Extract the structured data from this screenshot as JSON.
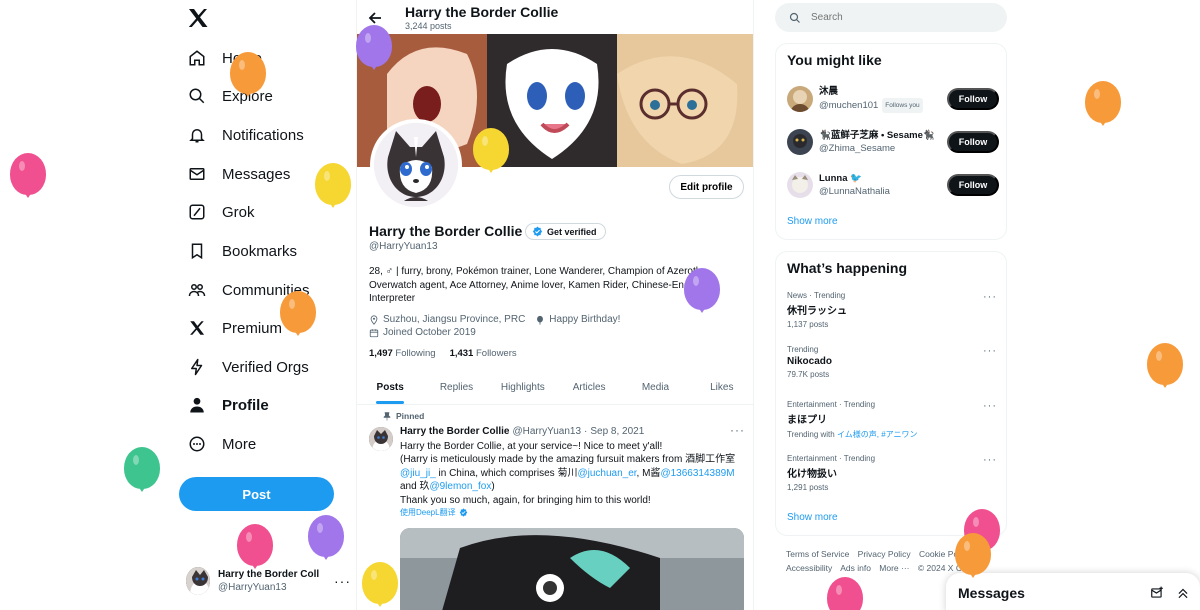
{
  "colors": {
    "accent": "#1d9bf0",
    "text": "#0f1419",
    "muted": "#536471",
    "balloon_orange": "#f79a3a",
    "balloon_yellow": "#f6d631",
    "balloon_pink": "#f0508f",
    "balloon_purple": "#a176ea",
    "balloon_green": "#3ec48e"
  },
  "nav": {
    "logo": "x-logo-icon",
    "items": [
      {
        "label": "Home",
        "icon": "home-icon"
      },
      {
        "label": "Explore",
        "icon": "search-icon"
      },
      {
        "label": "Notifications",
        "icon": "bell-icon"
      },
      {
        "label": "Messages",
        "icon": "envelope-icon"
      },
      {
        "label": "Grok",
        "icon": "grok-icon"
      },
      {
        "label": "Bookmarks",
        "icon": "bookmark-icon"
      },
      {
        "label": "Communities",
        "icon": "people-icon"
      },
      {
        "label": "Premium",
        "icon": "x-logo-icon"
      },
      {
        "label": "Verified Orgs",
        "icon": "lightning-icon"
      },
      {
        "label": "Profile",
        "icon": "person-icon",
        "active": true
      },
      {
        "label": "More",
        "icon": "more-circle-icon"
      }
    ],
    "post_label": "Post",
    "account": {
      "name": "Harry the Border Coll",
      "handle": "@HarryYuan13",
      "more": "···"
    }
  },
  "profile": {
    "header_title": "Harry the Border Collie",
    "post_count": "3,244 posts",
    "edit_label": "Edit profile",
    "display_name": "Harry the Border Collie",
    "get_verified": "Get verified",
    "handle": "@HarryYuan13",
    "bio": "28, ♂ | furry, brony, Pokémon trainer, Lone Wanderer, Champion of Azeroth, Overwatch agent, Ace Attorney, Anime lover, Kamen Rider, Chinese-English Interpreter",
    "location": "Suzhou, Jiangsu Province, PRC",
    "birthday": "Happy Birthday!",
    "joined": "Joined October 2019",
    "following_count": "1,497",
    "following_label": "Following",
    "followers_count": "1,431",
    "followers_label": "Followers"
  },
  "tabs": [
    "Posts",
    "Replies",
    "Highlights",
    "Articles",
    "Media",
    "Likes"
  ],
  "tweet": {
    "pinned_label": "Pinned",
    "author": "Harry the Border Collie",
    "handle": "@HarryYuan13",
    "sep": "·",
    "date": "Sep 8, 2021",
    "line1": "Harry the Border Collie, at your service~! Nice to meet y'all!",
    "line2": "(Harry is meticulously made by the amazing fursuit makers from 酒脚工作室",
    "mention1": "@jiu_ji_",
    "line3a": " in China, which comprises 菊川",
    "mention2": "@juchuan_er",
    "line3b": ", M酱",
    "mention3": "@1366314389M",
    "line4a": "and 玖",
    "mention4": "@9lemon_fox",
    "line4b": ")",
    "line5": "Thank you so much, again, for bringing him to this world!",
    "translate": "使用DeepL翻译",
    "more": "···"
  },
  "search": {
    "placeholder": "Search"
  },
  "who_to_follow": {
    "title": "You might like",
    "users": [
      {
        "name": "沐晨",
        "handle": "@muchen101",
        "badge": "Follows you",
        "button": "Follow"
      },
      {
        "name": "🐈‍⬛蓝鲜子芝麻 • Sesame🐈‍⬛",
        "handle": "@Zhima_Sesame",
        "badge": "",
        "button": "Follow"
      },
      {
        "name": "Lunna 🐦",
        "handle": "@LunnaNathalia",
        "badge": "",
        "button": "Follow"
      }
    ],
    "show_more": "Show more"
  },
  "trends": {
    "title": "What’s happening",
    "items": [
      {
        "context": "News · Trending",
        "title": "休刊ラッシュ",
        "count": "1,137 posts",
        "with_prefix": "",
        "with_tags": ""
      },
      {
        "context": "Trending",
        "title": "Nikocado",
        "count": "79.7K posts",
        "with_prefix": "",
        "with_tags": ""
      },
      {
        "context": "Entertainment · Trending",
        "title": "まほプリ",
        "count": "",
        "with_prefix": "Trending with ",
        "with_tags": "イム様の声, #アニワン"
      },
      {
        "context": "Entertainment · Trending",
        "title": "化け物扱い",
        "count": "1,291 posts",
        "with_prefix": "",
        "with_tags": ""
      }
    ],
    "show_more": "Show more",
    "more": "···"
  },
  "footer": {
    "links": [
      "Terms of Service",
      "Privacy Policy",
      "Cookie Policy",
      "Accessibility",
      "Ads info",
      "More ···",
      "© 2024 X Corp."
    ]
  },
  "messages_drawer": {
    "title": "Messages"
  }
}
